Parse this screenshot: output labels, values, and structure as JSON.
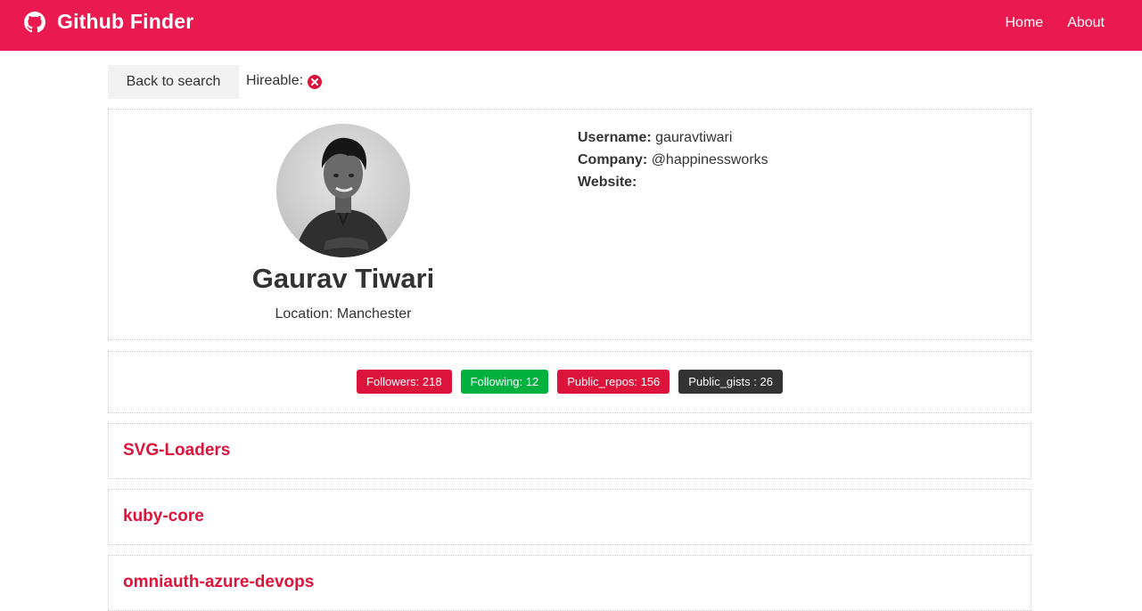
{
  "navbar": {
    "title": "Github Finder",
    "icon": "github-icon",
    "links": [
      "Home",
      "About"
    ],
    "color": "#ea1a50"
  },
  "actions": {
    "back_label": "Back to search",
    "hireable_label": "Hireable:",
    "hireable_icon": "x-circle-icon",
    "hireable_color": "#dc143c"
  },
  "profile": {
    "name": "Gaurav Tiwari",
    "location": "Location: Manchester",
    "avatar": "avatar-photo",
    "username_label": "Username:",
    "username": "gauravtiwari",
    "company_label": "Company:",
    "company": "@happinessworks",
    "website_label": "Website:",
    "website": ""
  },
  "stats": [
    {
      "label": "Followers: 218",
      "color": "#dc143c"
    },
    {
      "label": "Following: 12",
      "color": "#00b140"
    },
    {
      "label": "Public_repos: 156",
      "color": "#dc143c"
    },
    {
      "label": "Public_gists : 26",
      "color": "#333333"
    }
  ],
  "repos": [
    "SVG-Loaders",
    "kuby-core",
    "omniauth-azure-devops"
  ]
}
